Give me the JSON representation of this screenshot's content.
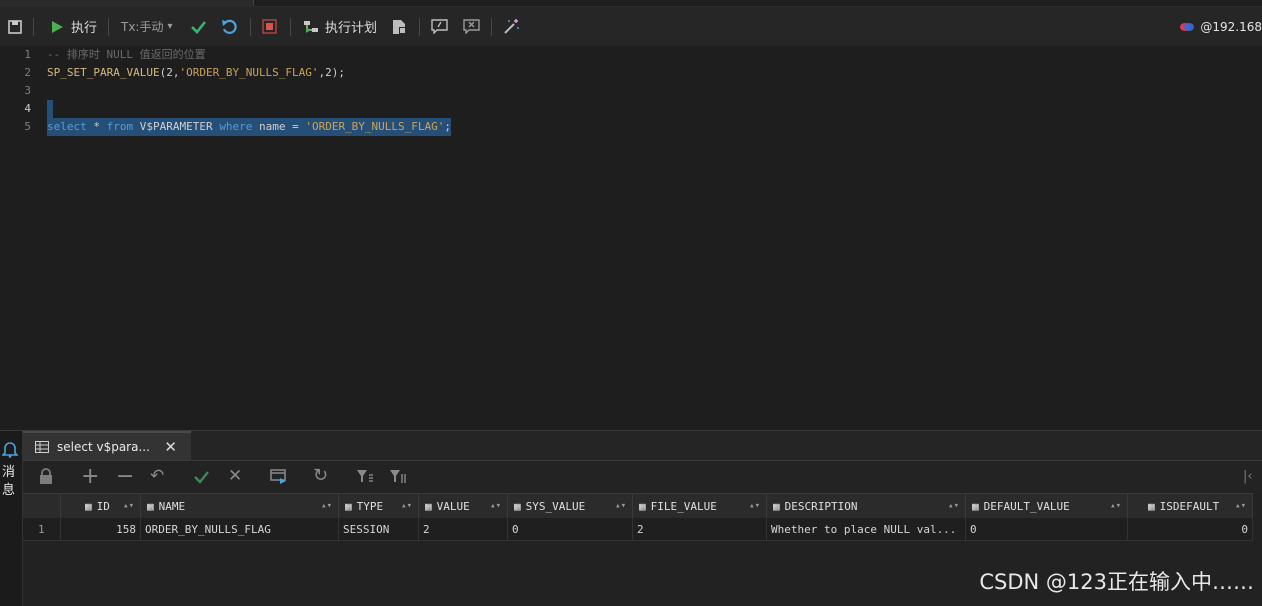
{
  "toolbar": {
    "run_label": "执行",
    "tx_mode": "Tx:手动",
    "plan_label": "执行计划",
    "connection": "@192.168"
  },
  "editor": {
    "lines": [
      {
        "num": "1",
        "text": "-- 排序时 NULL 值返回的位置"
      },
      {
        "num": "2",
        "fn": "SP_SET_PARA_VALUE",
        "args1": "(2,",
        "str": "'ORDER_BY_NULLS_FLAG'",
        "args2": ",2);"
      },
      {
        "num": "3"
      },
      {
        "num": "4"
      },
      {
        "num": "5",
        "select": "select",
        "star": " * ",
        "from": "from",
        "tbl": " V$PARAMETER ",
        "where": "where",
        "cond": " name = ",
        "str": "'ORDER_BY_NULLS_FLAG'",
        "end": ";"
      }
    ]
  },
  "results": {
    "side_label_1": "消",
    "side_label_2": "息",
    "tab_title": "select v$para...",
    "columns": [
      "ID",
      "NAME",
      "TYPE",
      "VALUE",
      "SYS_VALUE",
      "FILE_VALUE",
      "DESCRIPTION",
      "DEFAULT_VALUE",
      "ISDEFAULT"
    ],
    "rows": [
      {
        "row_num": "1",
        "cells": [
          "158",
          "ORDER_BY_NULLS_FLAG",
          "SESSION",
          "2",
          "0",
          "2",
          "Whether to place NULL val...",
          "0",
          "0"
        ]
      }
    ]
  },
  "watermark": "CSDN @123正在输入中……",
  "colors": {
    "run_green": "#4caf50",
    "check_green": "#3cb371",
    "undo_blue": "#4aa3df",
    "stop_red": "#d9534f",
    "selection": "#264f78"
  }
}
